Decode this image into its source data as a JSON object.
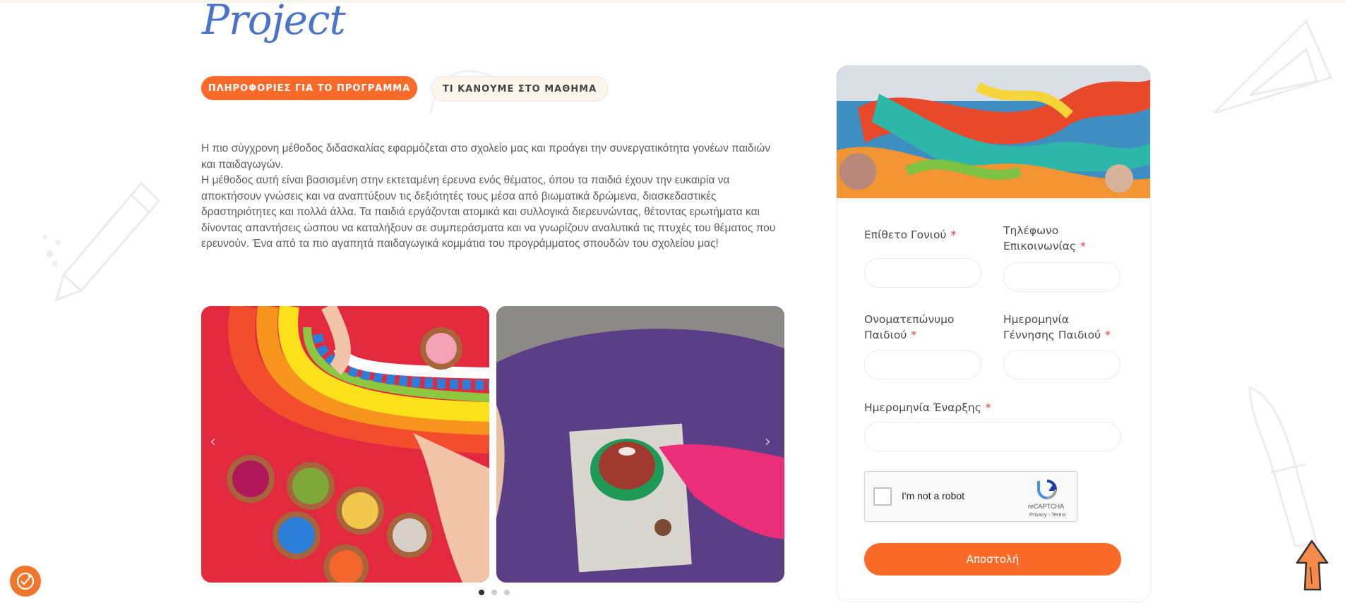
{
  "brand": {
    "text": "Project"
  },
  "tabs": [
    {
      "label": "ΠΛΗΡΟΦΟΡΙΕΣ ΓΙΑ ΤΟ ΠΡΟΓΡΑΜΜΑ",
      "active": true
    },
    {
      "label": "ΤΙ ΚΑΝΟΥΜΕ ΣΤΟ ΜΑΘΗΜΑ",
      "active": false
    }
  ],
  "description": [
    "Η πιο σύγχρονη μέθοδος διδασκαλίας εφαρμόζεται στο σχολείο μας και προάγει την συνεργατικότητα γονέων παιδιών και παιδαγωγών.",
    "Η μέθοδος αυτή είναι βασισμένη στην εκτεταμένη έρευνα ενός θέματος, όπου τα παιδιά έχουν την ευκαιρία να αποκτήσουν γνώσεις και να αναπτύξουν τις δεξιότητές τους μέσα από βιωματικά δρώμενα, διασκεδαστικές δραστηριότητες και πολλά άλλα. Τα παιδιά εργάζονται ατομικά και συλλογικά διερευνώντας, θέτοντας ερωτήματα και δίνοντας απαντήσεις ώσπου να καταλήξουν σε συμπεράσματα και να γνωρίζουν αναλυτικά τις πτυχές του θέματος που ερευνούν. Ένα από τα πιο αγαπητά παιδαγωγικά κομμάτια του προγράμματος σπουδών του σχολείου μας!"
  ],
  "carousel": {
    "prev_icon": "chevron-left-icon",
    "next_icon": "chevron-right-icon",
    "dots": [
      true,
      false,
      false
    ],
    "prev_symbol": "‹",
    "next_symbol": "›"
  },
  "form": {
    "parent_surname": {
      "label": "Επίθετο Γονιού",
      "value": ""
    },
    "phone": {
      "label_line1": "Τηλέφωνο",
      "label_line2": "Επικοινωνίας",
      "value": ""
    },
    "child_name": {
      "label_line1": "Ονοματεπώνυμο",
      "label_line2": "Παιδιού",
      "value": ""
    },
    "child_birthdate": {
      "label_line1": "Ημερομηνία",
      "label_line2": "Γέννησης Παιδιού",
      "value": ""
    },
    "start_date": {
      "label": "Ημερομηνία Έναρξης",
      "value": ""
    },
    "required_mark": "*",
    "recaptcha": {
      "text": "I'm not a robot",
      "brand": "reCAPTCHA",
      "terms": "Privacy - Terms"
    },
    "submit_label": "Αποστολή"
  },
  "colors": {
    "accent": "#fa6b2a",
    "brand_blue": "#4a74c9",
    "required": "#e03a3a"
  }
}
